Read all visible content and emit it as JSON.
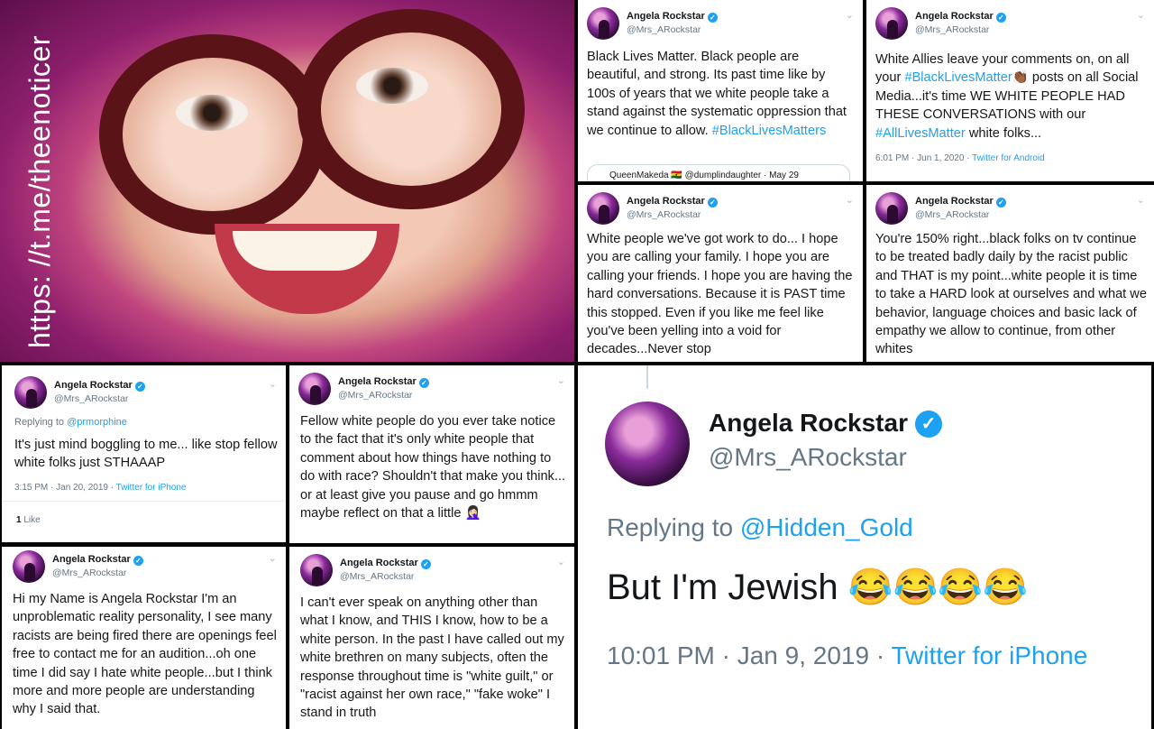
{
  "watermark": "https: //t.me/theenoticer",
  "account": {
    "name": "Angela Rockstar",
    "handle": "@Mrs_ARockstar"
  },
  "tweets": [
    {
      "text": "Black Lives Matter. Black people are beautiful, and strong. Its past time like by 100s of years that we white people take a stand against the systematic oppression that we continue to allow.",
      "hashtag": "#BlackLivesMatters",
      "quote": "QueenMakeda 🇬🇭 @dumplindaughter · May 29"
    },
    {
      "text_parts": [
        "White Allies leave your comments on, on all your ",
        "#BlackLivesMatter",
        "👏🏾 posts on all Social Media...it's time WE WHITE PEOPLE HAD THESE CONVERSATIONS with our ",
        "#AllLivesMatter",
        " white folks..."
      ],
      "time": "6:01 PM · Jun 1, 2020 · ",
      "client": "Twitter for Android"
    },
    {
      "text": "White people we've got work to do... I hope you are calling your family. I hope you are calling your friends. I hope you are having the hard conversations. Because it is PAST time this stopped. Even if you like me feel like you've been yelling into a void for decades...Never stop"
    },
    {
      "text": "You're 150% right...black folks on tv continue to be treated badly daily by the racist public and THAT is my point...white people it is time to take a HARD look at ourselves and what we behavior, language choices and basic lack of empathy we allow to continue, from other whites"
    },
    {
      "replying": "Replying to ",
      "reply_to": "@prmorphine",
      "text": "It's just mind boggling to me... like stop fellow white folks just STHAAAP",
      "time": "3:15 PM · Jan 20, 2019 · ",
      "client": "Twitter for iPhone",
      "likes": "1",
      "likes_label": " Like"
    },
    {
      "text": "Fellow white people do you ever take notice to the fact that it's only white people that comment about how things have nothing to do with race? Shouldn't that make you think... or at least give you pause and go hmmm maybe reflect on that a little 🤦🏻‍♀️"
    },
    {
      "text": "Hi my Name is Angela Rockstar I'm an unproblematic reality personality, I see many racists are being fired there are openings feel free to contact me for an audition...oh one time I did say I hate white people...but I think more and more people are understanding why I said that."
    },
    {
      "text": "I can't ever speak on anything other than what I know, and THIS I know, how to be a white person. In the past I have called out my white brethren on many subjects, often the response throughout time is \"white guilt,\" or \"racist against her own race,\" \"fake woke\" I stand in truth"
    }
  ],
  "big": {
    "replying": "Replying to ",
    "reply_to": "@Hidden_Gold",
    "text": "But I'm Jewish 😂😂😂😂",
    "time": "10:01 PM · Jan 9, 2019 · ",
    "client": "Twitter for iPhone"
  },
  "icons": {
    "verified": "✓",
    "chevron": "⌄"
  }
}
